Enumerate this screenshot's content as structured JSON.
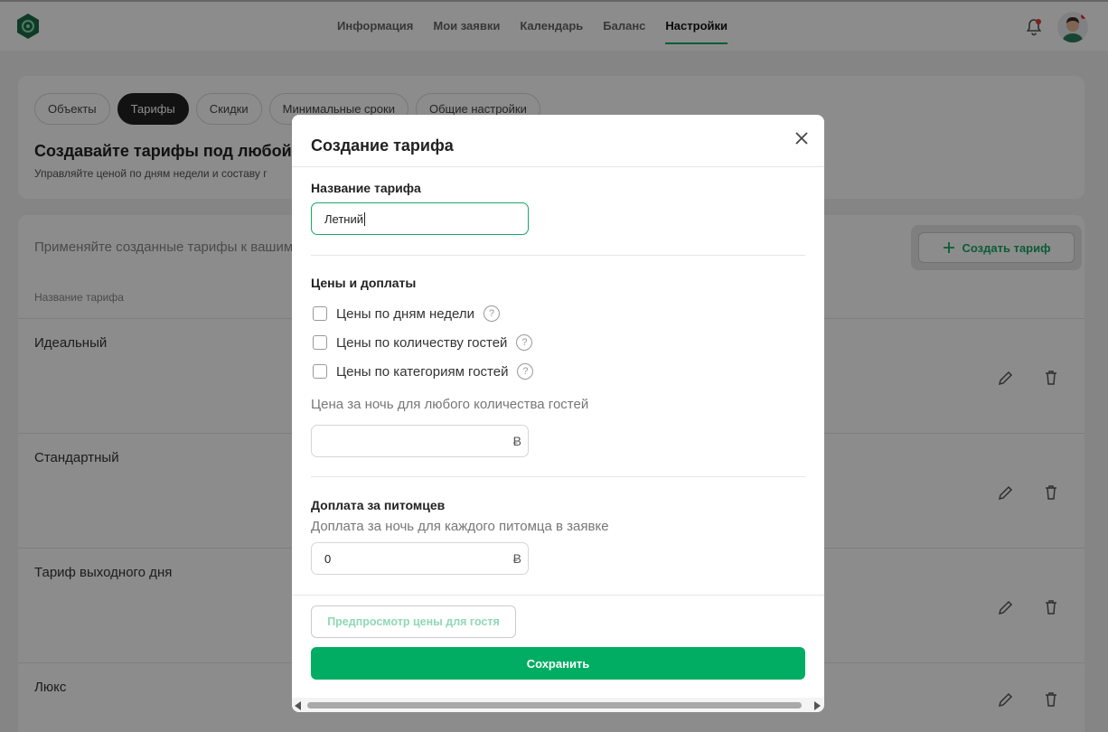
{
  "nav": {
    "items": [
      "Информация",
      "Мои заявки",
      "Календарь",
      "Баланс",
      "Настройки"
    ],
    "active": "Настройки"
  },
  "tabs": [
    "Объекты",
    "Тарифы",
    "Скидки",
    "Минимальные сроки",
    "Общие настройки"
  ],
  "active_tab": "Тарифы",
  "page": {
    "heading": "Создавайте тарифы под любой",
    "subheading": "Управляйте ценой по дням недели и составу г",
    "apply_text": "Применяйте созданные тарифы к вашим",
    "create_button": "Создать тариф",
    "column_header": "Название тарифа",
    "rows": [
      "Идеальный",
      "Стандартный",
      "Тариф выходного дня",
      "Люкс"
    ]
  },
  "modal": {
    "title": "Создание тарифа",
    "name_label": "Название тарифа",
    "name_value": "Летний",
    "prices_label": "Цены и доплаты",
    "options": [
      "Цены по дням недели",
      "Цены по количеству гостей",
      "Цены по категориям гостей"
    ],
    "night_price_label": "Цена за ночь для любого количества гостей",
    "night_price_value": "",
    "currency": "Ƀ",
    "pets_label": "Доплата за питомцев",
    "pets_hint": "Доплата за ночь для каждого питомца в заявке",
    "pets_value": "0",
    "preview_button": "Предпросмотр цены для гостя",
    "save_button": "Сохранить"
  },
  "colors": {
    "accent": "#00ad63",
    "accent_light": "#8fd8b5",
    "overlay": "rgba(0,0,0,0.45)"
  }
}
